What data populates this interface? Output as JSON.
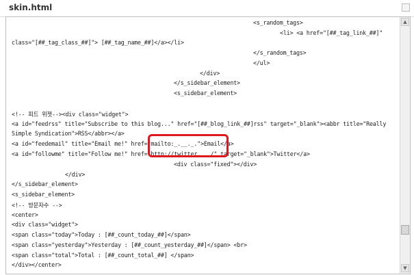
{
  "window": {
    "title": "skin.html"
  },
  "editor": {
    "lines": [
      "<s_random_tags>",
      "<li> <a href=\"[##_tag_link_##]\"",
      "class=\"[##_tag_class_##]\"> [##_tag_name_##]</a></li>",
      "</s_random_tags>",
      "</ul>",
      "</div>",
      "</s_sidebar_element>",
      "<s_sidebar_element>",
      "<!-- 피드 위젯--><div class=\"widget\">",
      "<a id=\"feedrss\" title=\"Subscribe to this blog...\" href=\"[##_blog_link_##]rss\" target=\"_blank\"><abbr title=\"Really",
      "Simple Syndication\">RSS</abbr></a>",
      "<a id=\"feedemail\" title=\"Email me!\" href=\"mailto:_.__._.\">Email</a>",
      "<a id=\"followme\" title=\"Follow me!\" href=\"http://twitter.___/\" target=\"_blank\">Twitter</a>",
      "<div class=\"fixed\"></div>",
      "</div>",
      "</s_sidebar_element>",
      "<s_sidebar_element>",
      "<!-- 방문자수 -->",
      "<center>",
      "<div class=\"widget\">",
      "<span class=\"today\">Today : [##_count_today_##]</span>",
      "<span class=\"yesterday\">Yesterday : [##_count_yesterday_##]</span> <br>",
      "<span class=\"total\">Total : [##_count_total_##] </span>",
      "</div></center>"
    ]
  },
  "scrollbar": {
    "up_arrow": "▲",
    "down_arrow": "▼"
  },
  "colors": {
    "highlight": "#e0181d"
  }
}
